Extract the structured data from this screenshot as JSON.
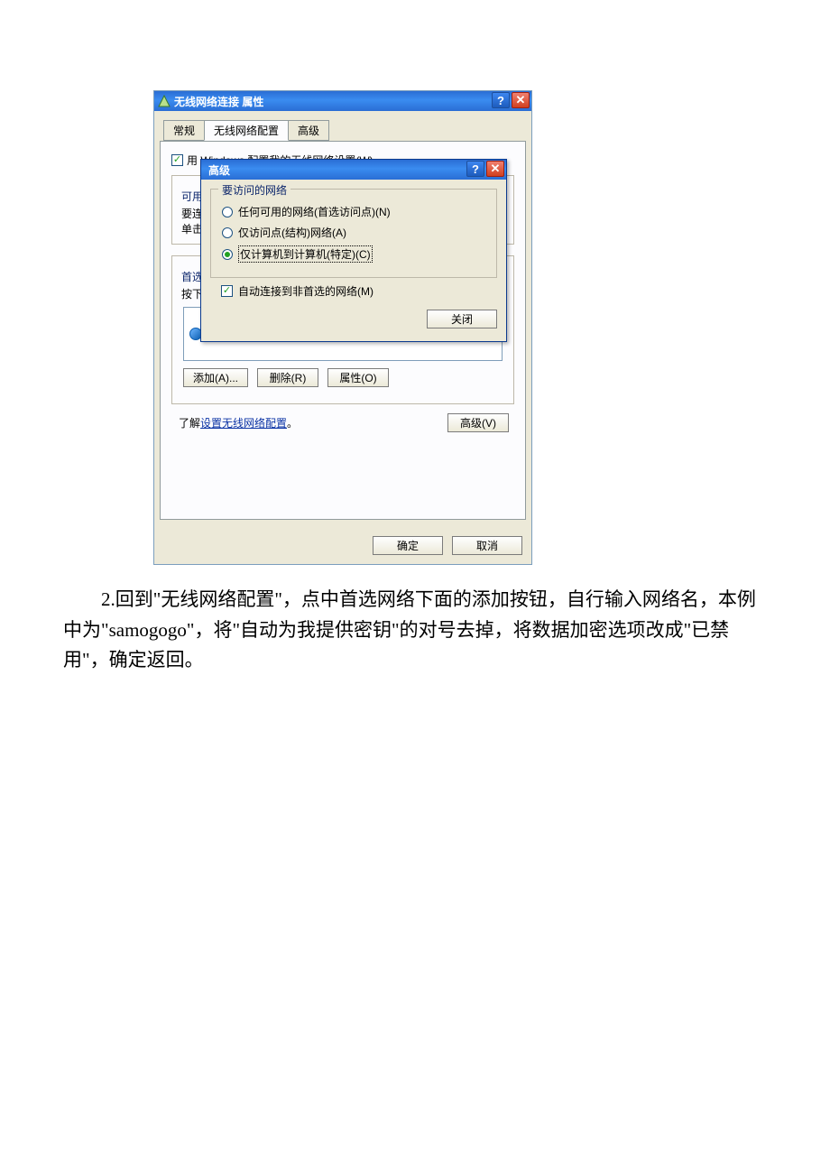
{
  "main_dialog": {
    "title": "无线网络连接  属性",
    "tabs": {
      "general": "常规",
      "wireless": "无线网络配置",
      "advanced": "高级"
    },
    "use_windows_cfg": "用 Windows 配置我的无线网络设置(W)",
    "available_label": "可用",
    "need_text1": "要连",
    "need_text2": "单击",
    "preferred_label": "首选",
    "by_order": "按下",
    "buttons": {
      "add": "添加(A)...",
      "remove": "删除(R)",
      "properties": "属性(O)"
    },
    "learn_prefix": "了解",
    "learn_link": "设置无线网络配置",
    "learn_suffix": "。",
    "advanced_btn": "高级(V)",
    "ok": "确定",
    "cancel": "取消"
  },
  "overlay": {
    "title": "高级",
    "group_title": "要访问的网络",
    "opt_any": "任何可用的网络(首选访问点)(N)",
    "opt_ap": "仅访问点(结构)网络(A)",
    "opt_adhoc": "仅计算机到计算机(特定)(C)",
    "auto_connect": "自动连接到非首选的网络(M)",
    "close": "关闭"
  },
  "article": {
    "p1": "2.回到\"无线网络配置\"，点中首选网络下面的添加按钮，自行输入网络名，本例中为\"samogogo\"，将\"自动为我提供密钥\"的对号去掉，将数据加密选项改成\"已禁用\"，确定返回。"
  }
}
